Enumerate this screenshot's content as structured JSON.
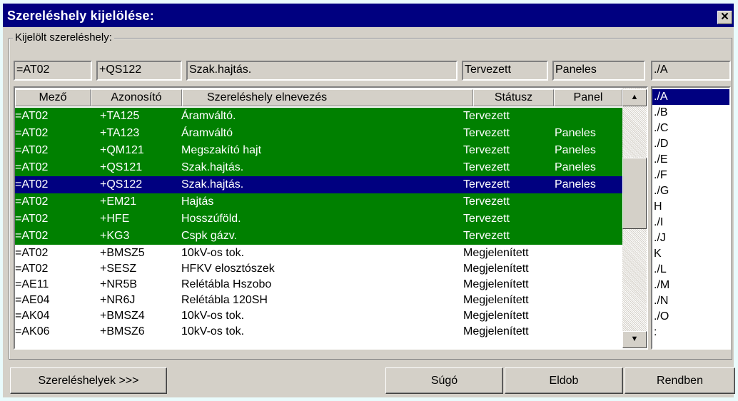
{
  "window": {
    "title": "Szereléshely kijelölése:",
    "close_label": "✕"
  },
  "group": {
    "label": "Kijelölt szereléshely:"
  },
  "fields": {
    "mezo": "=AT02",
    "azonosito": "+QS122",
    "elnevezes": "Szak.hajtás.",
    "statusz": "Tervezett",
    "panel": "Paneles",
    "path": "./A"
  },
  "table": {
    "headers": [
      "Mező",
      "Azonosító",
      "Szereléshely elnevezés",
      "Státusz",
      "Panel"
    ],
    "rows": [
      [
        "=AT02",
        "+TA125",
        "Áramváltó.",
        "Tervezett",
        ""
      ],
      [
        "=AT02",
        "+TA123",
        "Áramváltó",
        "Tervezett",
        "Paneles"
      ],
      [
        "=AT02",
        "+QM121",
        "Megszakító hajt",
        "Tervezett",
        "Paneles"
      ],
      [
        "=AT02",
        "+QS121",
        "Szak.hajtás.",
        "Tervezett",
        "Paneles"
      ],
      [
        "=AT02",
        "+QS122",
        "Szak.hajtás.",
        "Tervezett",
        "Paneles"
      ],
      [
        "=AT02",
        "+EM21",
        "Hajtás",
        "Tervezett",
        ""
      ],
      [
        "=AT02",
        "+HFE",
        "Hosszúföld.",
        "Tervezett",
        ""
      ],
      [
        "=AT02",
        "+KG3",
        "Cspk gázv.",
        "Tervezett",
        ""
      ],
      [
        "=AT02",
        "+BMSZ5",
        "10kV-os tok.",
        "Megjelenített",
        ""
      ],
      [
        "=AT02",
        "+SESZ",
        "HFKV elosztószek",
        "Megjelenített",
        ""
      ],
      [
        "=AE11",
        "+NR5B",
        "Relétábla Hszobo",
        "Megjelenített",
        ""
      ],
      [
        "=AE04",
        "+NR6J",
        "Relétábla 120SH",
        "Megjelenített",
        ""
      ],
      [
        "=AK04",
        "+BMSZ4",
        "10kV-os tok.",
        "Megjelenített",
        ""
      ],
      [
        "=AK06",
        "+BMSZ6",
        "10kV-os tok.",
        "Megjelenített",
        ""
      ]
    ],
    "scroll_up_icon": "▲",
    "scroll_down_icon": "▼"
  },
  "path_list": [
    "./A",
    "./B",
    "./C",
    "./D",
    "./E",
    "./F",
    "./G",
    "H",
    "./I",
    "./J",
    "K",
    "./L",
    "./M",
    "./N",
    "./O",
    ":"
  ],
  "buttons": {
    "locations": "Szereléshelyek >>>",
    "help": "Súgó",
    "discard": "Eldob",
    "ok": "Rendben"
  },
  "colors": {
    "titlebar": "#000080",
    "highlight_green": "#008000",
    "selection": "#000080",
    "face": "#d4d0c8"
  }
}
